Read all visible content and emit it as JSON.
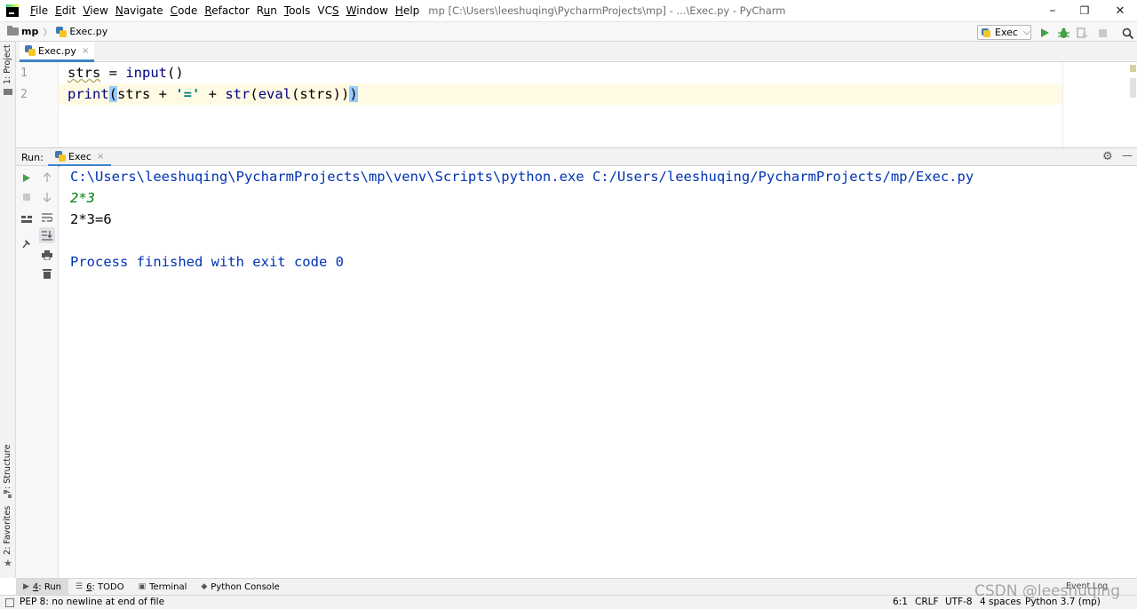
{
  "titlebar": {
    "menu": [
      {
        "pre": "",
        "u": "F",
        "post": "ile"
      },
      {
        "pre": "",
        "u": "E",
        "post": "dit"
      },
      {
        "pre": "",
        "u": "V",
        "post": "iew"
      },
      {
        "pre": "",
        "u": "N",
        "post": "avigate"
      },
      {
        "pre": "",
        "u": "C",
        "post": "ode"
      },
      {
        "pre": "",
        "u": "R",
        "post": "efactor"
      },
      {
        "pre": "R",
        "u": "u",
        "post": "n"
      },
      {
        "pre": "",
        "u": "T",
        "post": "ools"
      },
      {
        "pre": "VC",
        "u": "S",
        "post": ""
      },
      {
        "pre": "",
        "u": "W",
        "post": "indow"
      },
      {
        "pre": "",
        "u": "H",
        "post": "elp"
      }
    ],
    "window_title": "mp [C:\\Users\\leeshuqing\\PycharmProjects\\mp] - ...\\Exec.py - PyCharm",
    "minimize": "–",
    "restore": "❐",
    "close": "✕"
  },
  "navbar": {
    "project": "mp",
    "file": "Exec.py",
    "run_config": "Exec",
    "run_config_arrow": "⌵"
  },
  "left_stripe": {
    "project": "1: Project",
    "structure": "7: Structure",
    "favorites": "2: Favorites"
  },
  "editor": {
    "tab_label": "Exec.py",
    "tab_close": "×",
    "line_numbers": [
      "1",
      "2"
    ],
    "line1": {
      "var": "strs",
      "op": " = ",
      "fn": "input",
      "parens": "()"
    },
    "line2": {
      "fn": "print",
      "open": "(",
      "a": "strs + ",
      "str": "'='",
      "b": " + ",
      "fn2": "str",
      "c": "(",
      "fn3": "eval",
      "d": "(strs))",
      "close": ")"
    }
  },
  "run_panel": {
    "label": "Run:",
    "tab_label": "Exec",
    "tab_close": "×",
    "settings_glyph": "⚙",
    "hide_glyph": "—"
  },
  "console": {
    "lines": [
      {
        "text": "C:\\Users\\leeshuqing\\PycharmProjects\\mp\\venv\\Scripts\\python.exe C:/Users/leeshuqing/PycharmProjects/mp/Exec.py",
        "kind": "system"
      },
      {
        "text": "2*3",
        "kind": "input"
      },
      {
        "text": "2*3=6",
        "kind": "output"
      },
      {
        "text": "",
        "kind": "output"
      },
      {
        "text": "Process finished with exit code 0",
        "kind": "system"
      }
    ]
  },
  "bottom_tools": [
    {
      "u": "4",
      "label": ": Run",
      "glyph": "▶"
    },
    {
      "u": "6",
      "label": ": TODO",
      "glyph": "☰"
    },
    {
      "u": "",
      "label": "Terminal",
      "glyph": "▣"
    },
    {
      "u": "",
      "label": "Python Console",
      "glyph": "◆"
    }
  ],
  "event_log": "Event Log",
  "statusbar": {
    "message": "PEP 8: no newline at end of file",
    "position": "6:1",
    "line_sep": "CRLF",
    "encoding": "UTF-8",
    "indent": "4 spaces",
    "interpreter": "Python 3.7 (mp)"
  },
  "watermark": "CSDN @leeshuqing",
  "colors": {
    "keyword": "#000080",
    "string": "#008080",
    "system_text": "#0033b3",
    "input_text": "#067d17",
    "accent": "#4083c9"
  }
}
